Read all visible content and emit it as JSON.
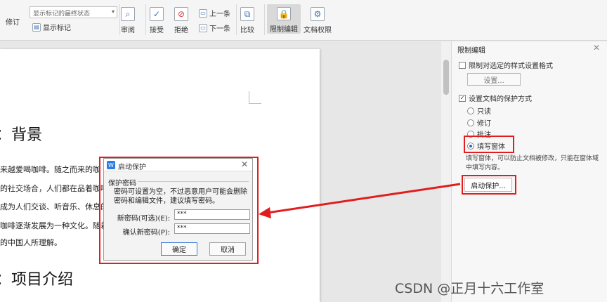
{
  "toolbar": {
    "revise": "修订",
    "show_markup": "显示标记",
    "markup_state": "显示标记的最终状态",
    "review": "审阅",
    "accept": "接受",
    "reject": "拒绝",
    "prev": "上一条",
    "next": "下一条",
    "compare": "比较",
    "restrict_edit": "限制编辑",
    "doc_permission": "文档权限"
  },
  "document": {
    "heading1": "：背景",
    "lines": [
      "来越爱喝咖啡。随之而来的咖",
      "的社交场合，人们都在品着咖啡",
      "成为人们交谈、听音乐、休息的",
      "咖啡逐渐发展为一种文化。随着",
      "的中国人所理解。"
    ],
    "heading2": "：项目介绍"
  },
  "panel": {
    "title": "限制编辑",
    "restrict_format": "限制对选定的样式设置格式",
    "settings_btn": "设置...",
    "set_protection": "设置文档的保护方式",
    "opt_readonly": "只读",
    "opt_revise": "修订",
    "opt_comment": "批注",
    "opt_form": "填写窗体",
    "desc": "填写窗体，可以防止文档被修改，只能在窗体域中填写内容。",
    "start_btn": "启动保护..."
  },
  "dialog": {
    "title": "启动保护",
    "group": "保护密码",
    "note": "密码可设置为空，不过恶意用户可能会删除密码和编辑文件，建议填写密码。",
    "new_pwd_label": "新密码(可选)(E):",
    "new_pwd_value": "***",
    "confirm_label": "确认新密码(P):",
    "confirm_value": "***",
    "ok": "确定",
    "cancel": "取消"
  },
  "watermark": "CSDN @正月十六工作室",
  "colors": {
    "highlight": "#e11d1d",
    "accent": "#2f7de1"
  }
}
